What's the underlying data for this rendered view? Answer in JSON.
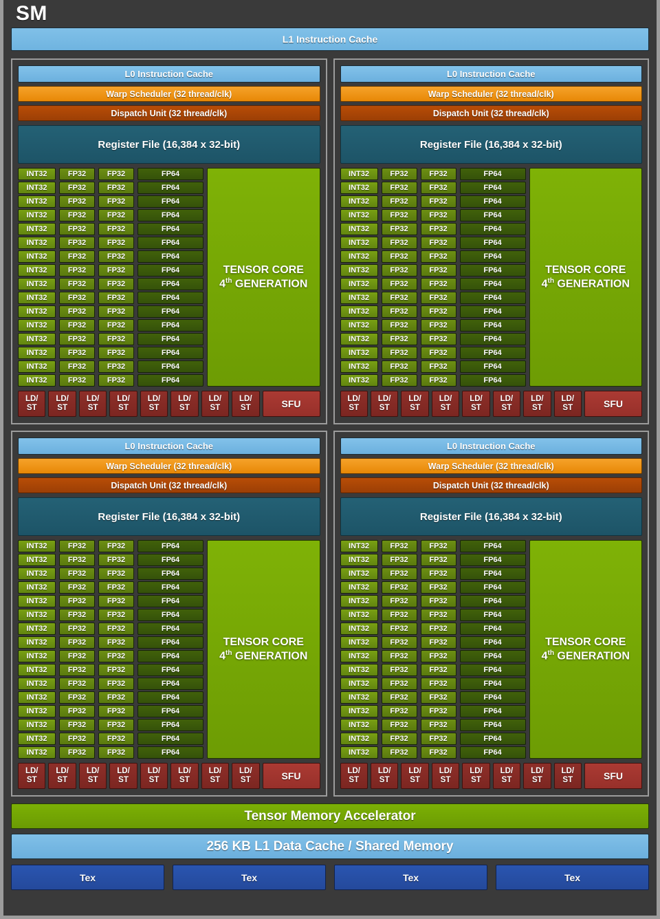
{
  "diagram": {
    "title": "SM",
    "l1_instruction_cache": "L1 Instruction Cache",
    "tensor_memory_accelerator": "Tensor Memory Accelerator",
    "l1_data_cache": "256 KB L1 Data Cache / Shared Memory",
    "tex_units": [
      "Tex",
      "Tex",
      "Tex",
      "Tex"
    ],
    "colors": {
      "background": "#3a3a3a",
      "frame_border": "#9c9c9c",
      "cache_blue": "#6fb4e0",
      "warp_orange": "#ef8d0c",
      "dispatch_brown": "#a84206",
      "register_teal": "#1d5467",
      "int32_green": "#679013",
      "fp32_green": "#5f800f",
      "fp64_green": "#3a590a",
      "tensor_green": "#76a905",
      "ldst_red": "#832a24",
      "sfu_red": "#a2342d",
      "tex_blue": "#26509f",
      "text_white": "#ffffff"
    }
  },
  "processing_block": {
    "l0_instruction_cache": "L0 Instruction Cache",
    "warp_scheduler": "Warp Scheduler (32 thread/clk)",
    "dispatch_unit": "Dispatch Unit (32 thread/clk)",
    "register_file": "Register File (16,384 x 32-bit)",
    "core_rows": 16,
    "int32_label": "INT32",
    "fp32_label": "FP32",
    "fp64_label": "FP64",
    "tensor_core_line1": "TENSOR CORE",
    "tensor_core_line2_prefix": "4",
    "tensor_core_line2_sup": "th",
    "tensor_core_line2_suffix": "GENERATION",
    "ldst_label_line1": "LD/",
    "ldst_label_line2": "ST",
    "ldst_count": 8,
    "sfu_label": "SFU"
  },
  "blocks": [
    {
      "name": "processing-block-top-left"
    },
    {
      "name": "processing-block-top-right"
    },
    {
      "name": "processing-block-bottom-left"
    },
    {
      "name": "processing-block-bottom-right"
    }
  ]
}
